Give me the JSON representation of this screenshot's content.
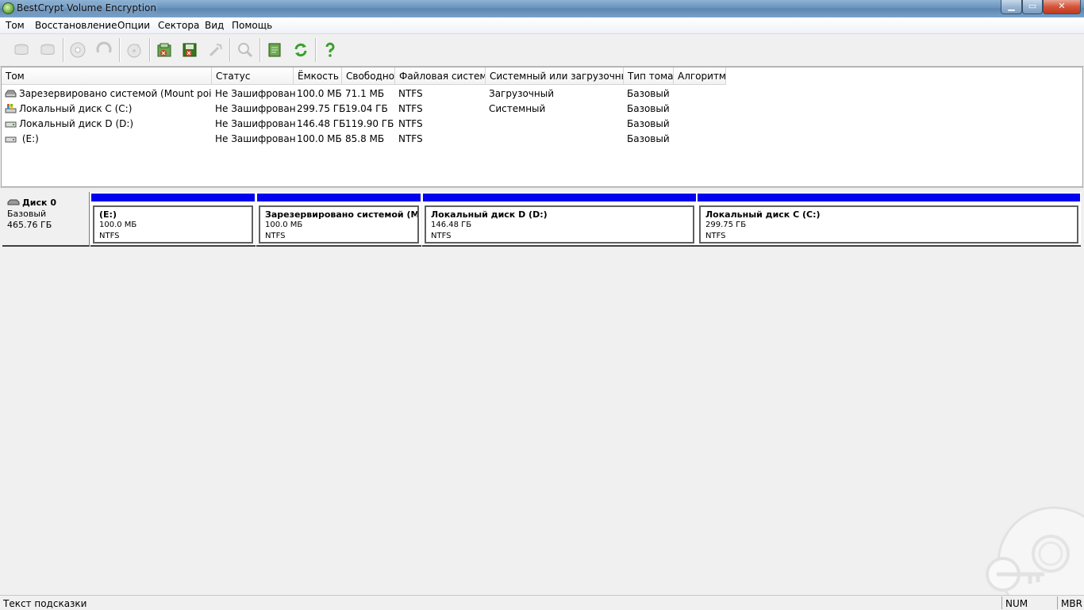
{
  "window": {
    "title": "BestCrypt Volume Encryption"
  },
  "menu": [
    "Том",
    "Восстановление",
    "Опции",
    "Сектора",
    "Вид",
    "Помощь"
  ],
  "toolbar": {
    "buttons": [
      {
        "icon": "encrypt-disk-icon",
        "enabled": false
      },
      {
        "icon": "decrypt-disk-icon",
        "enabled": false
      },
      {
        "icon": "mount-icon",
        "enabled": false
      },
      {
        "icon": "dismount-icon",
        "enabled": false
      },
      {
        "icon": "settings-disk-icon",
        "enabled": false
      },
      {
        "icon": "rescue-icon",
        "enabled": true
      },
      {
        "icon": "save-key-icon",
        "enabled": true
      },
      {
        "icon": "key-generator-icon",
        "enabled": false
      },
      {
        "icon": "search-icon",
        "enabled": false
      },
      {
        "icon": "report-icon",
        "enabled": true
      },
      {
        "icon": "refresh-icon",
        "enabled": true
      },
      {
        "icon": "help-icon",
        "enabled": true
      }
    ]
  },
  "columns": [
    "Том",
    "Статус",
    "Ёмкость",
    "Свободно",
    "Файловая система",
    "Системный или загрузочный",
    "Тип тома",
    "Алгоритм"
  ],
  "volumes": [
    {
      "name": "Зарезервировано системой (Mount point \\)",
      "status": "Не Зашифрован",
      "capacity": "100.0 МБ",
      "free": "71.1 МБ",
      "fs": "NTFS",
      "role": "Загрузочный",
      "type": "Базовый",
      "algorithm": ""
    },
    {
      "name": "Локальный диск C (C:)",
      "status": "Не Зашифрован",
      "capacity": "299.75 ГБ",
      "free": "19.04 ГБ",
      "fs": "NTFS",
      "role": "Системный",
      "type": "Базовый",
      "algorithm": ""
    },
    {
      "name": "Локальный диск D (D:)",
      "status": "Не Зашифрован",
      "capacity": "146.48 ГБ",
      "free": "119.90 ГБ",
      "fs": "NTFS",
      "role": "",
      "type": "Базовый",
      "algorithm": ""
    },
    {
      "name": " (E:)",
      "status": "Не Зашифрован",
      "capacity": "100.0 МБ",
      "free": "85.8 МБ",
      "fs": "NTFS",
      "role": "",
      "type": "Базовый",
      "algorithm": ""
    }
  ],
  "disk": {
    "name": "Диск 0",
    "type": "Базовый",
    "size": "465.76 ГБ",
    "bar_color": "#0000ee",
    "partitions": [
      {
        "name": "(E:)",
        "size": "100.0 МБ",
        "fs": "NTFS"
      },
      {
        "name": "Зарезервировано системой (Mount point \\)",
        "size": "100.0 МБ",
        "fs": "NTFS"
      },
      {
        "name": "Локальный диск D (D:)",
        "size": "146.48 ГБ",
        "fs": "NTFS"
      },
      {
        "name": "Локальный диск C (C:)",
        "size": "299.75 ГБ",
        "fs": "NTFS"
      }
    ]
  },
  "statusbar": {
    "hint": "Текст подсказки",
    "num": "NUM",
    "mbr": "MBR"
  }
}
